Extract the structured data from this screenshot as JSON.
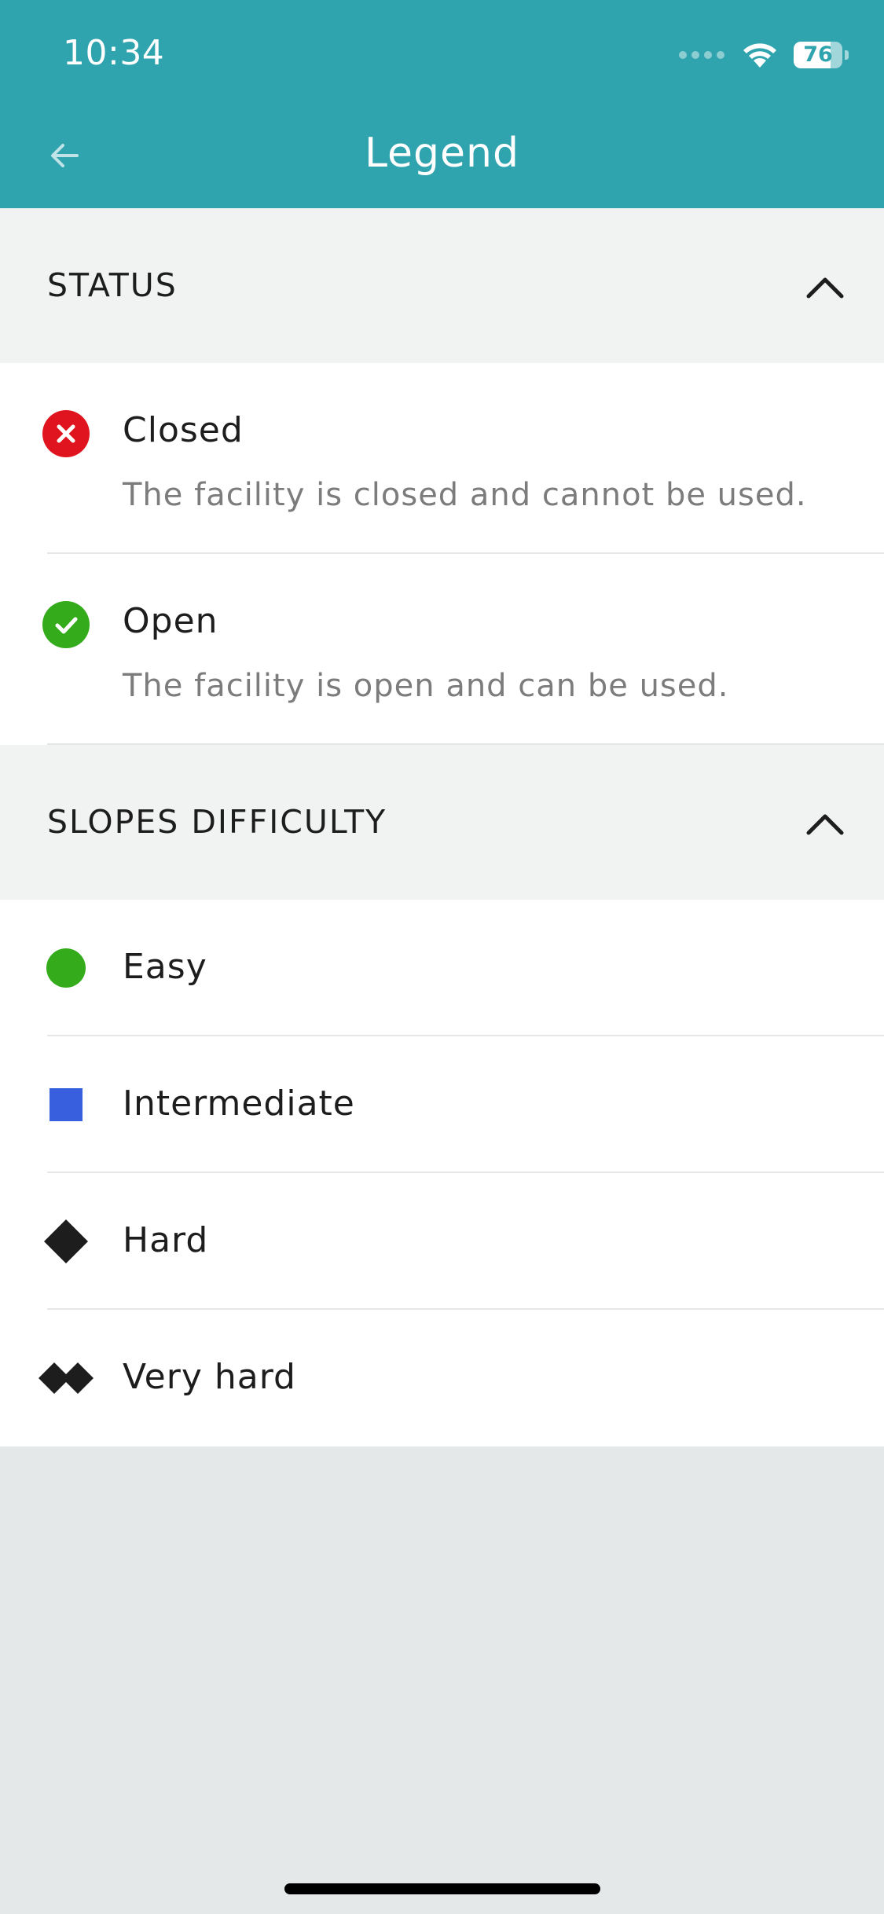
{
  "status_bar": {
    "time": "10:34",
    "battery_percent": "76",
    "battery_level": 0.76
  },
  "header": {
    "title": "Legend",
    "back_icon": "arrow-left-icon"
  },
  "colors": {
    "header_bg": "#2fa4ae",
    "closed": "#e0141e",
    "open": "#33ab1a",
    "easy": "#33ab1a",
    "intermediate": "#3860de",
    "hard": "#1d1d1d"
  },
  "sections": {
    "status": {
      "title": "STATUS",
      "items": [
        {
          "label": "Closed",
          "description": "The facility is closed and cannot be used.",
          "icon": "closed-x-circle-icon"
        },
        {
          "label": "Open",
          "description": "The facility is open and can be used.",
          "icon": "open-check-circle-icon"
        }
      ]
    },
    "slopes": {
      "title": "SLOPES DIFFICULTY",
      "items": [
        {
          "label": "Easy",
          "icon": "green-circle-icon"
        },
        {
          "label": "Intermediate",
          "icon": "blue-square-icon"
        },
        {
          "label": "Hard",
          "icon": "black-diamond-icon"
        },
        {
          "label": "Very hard",
          "icon": "double-black-diamond-icon"
        }
      ]
    }
  }
}
